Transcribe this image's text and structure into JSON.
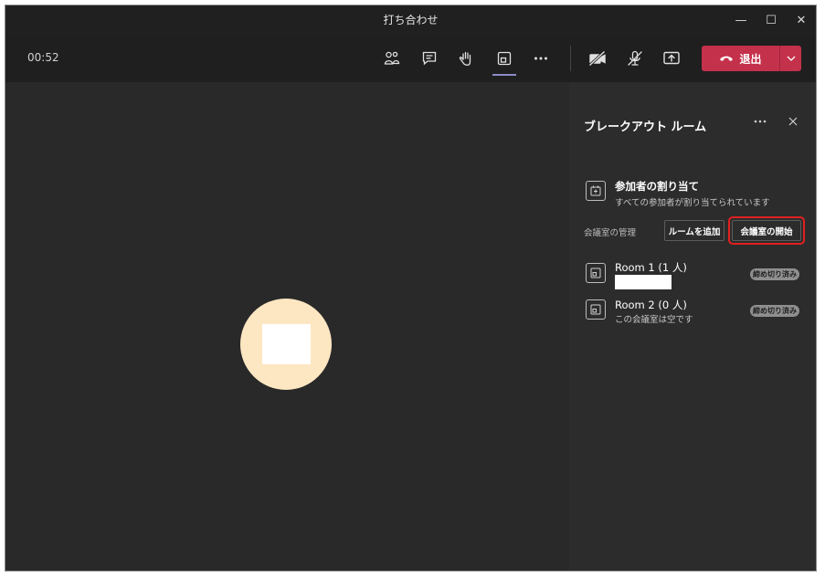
{
  "window": {
    "title": "打ち合わせ",
    "minimize_glyph": "—",
    "maximize_glyph": "☐",
    "close_glyph": "✕"
  },
  "toolbar": {
    "timer": "00:52",
    "icons": [
      "people-icon",
      "chat-icon",
      "raise-hand-icon",
      "breakout-rooms-icon",
      "more-icon",
      "camera-off-icon",
      "mic-off-icon",
      "share-screen-icon"
    ],
    "leave_label": "退出",
    "leave_color": "#c4314b"
  },
  "panel": {
    "title": "ブレークアウト ルーム",
    "assign_title": "参加者の割り当て",
    "assign_sub": "すべての参加者が割り当てられています",
    "manage_label": "会議室の管理",
    "add_room_label": "ルームを追加",
    "start_rooms_label": "会議室の開始",
    "highlight_color": "#e02020",
    "rooms": [
      {
        "name": "Room 1 (1 人)",
        "sub": "",
        "status": "締め切り済み"
      },
      {
        "name": "Room 2 (0 人)",
        "sub": "この会議室は空です",
        "status": "締め切り済み"
      }
    ]
  },
  "stage": {
    "avatar_color": "#fde7c2"
  }
}
